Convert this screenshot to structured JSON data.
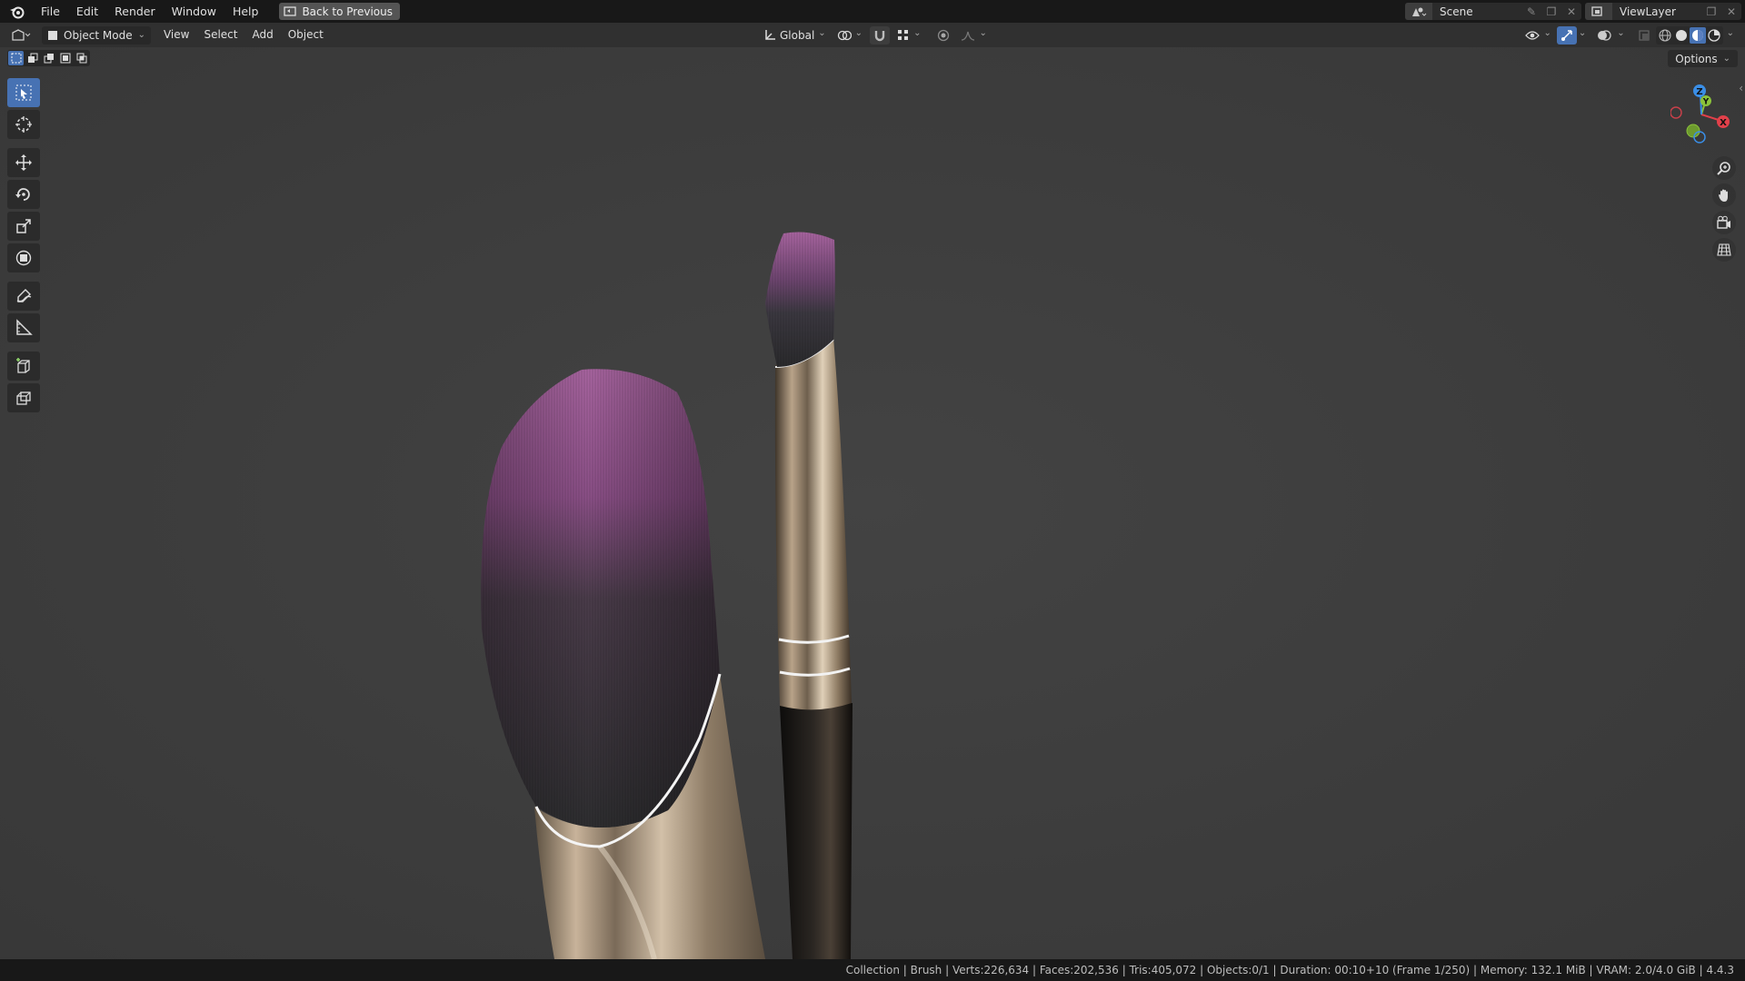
{
  "topbar": {
    "menus": [
      "File",
      "Edit",
      "Render",
      "Window",
      "Help"
    ],
    "back_label": "Back to Previous",
    "scene_name": "Scene",
    "view_layer_name": "ViewLayer"
  },
  "header": {
    "mode": "Object Mode",
    "menus": [
      "View",
      "Select",
      "Add",
      "Object"
    ],
    "orientation": "Global"
  },
  "viewport": {
    "options_label": "Options",
    "gizmo_axes": {
      "x": "X",
      "y": "Y",
      "z": "Z"
    },
    "tools": [
      "select-box",
      "cursor",
      "move",
      "rotate",
      "scale",
      "transform",
      "annotate",
      "measure",
      "add-cube",
      "extrude"
    ]
  },
  "status": {
    "text": "Collection | Brush | Verts:226,634 | Faces:202,536 | Tris:405,072 | Objects:0/1 | Duration: 00:10+10 (Frame 1/250) | Memory: 132.1 MiB | VRAM: 2.0/4.0 GiB | 4.4.3"
  },
  "colors": {
    "accent": "#4772b3",
    "viewport_bg": "#3d3d3d",
    "bristle_tip": "#9a5a95",
    "axis_x": "#e2404a",
    "axis_y": "#8bc33a",
    "axis_z": "#3a8ee6"
  }
}
